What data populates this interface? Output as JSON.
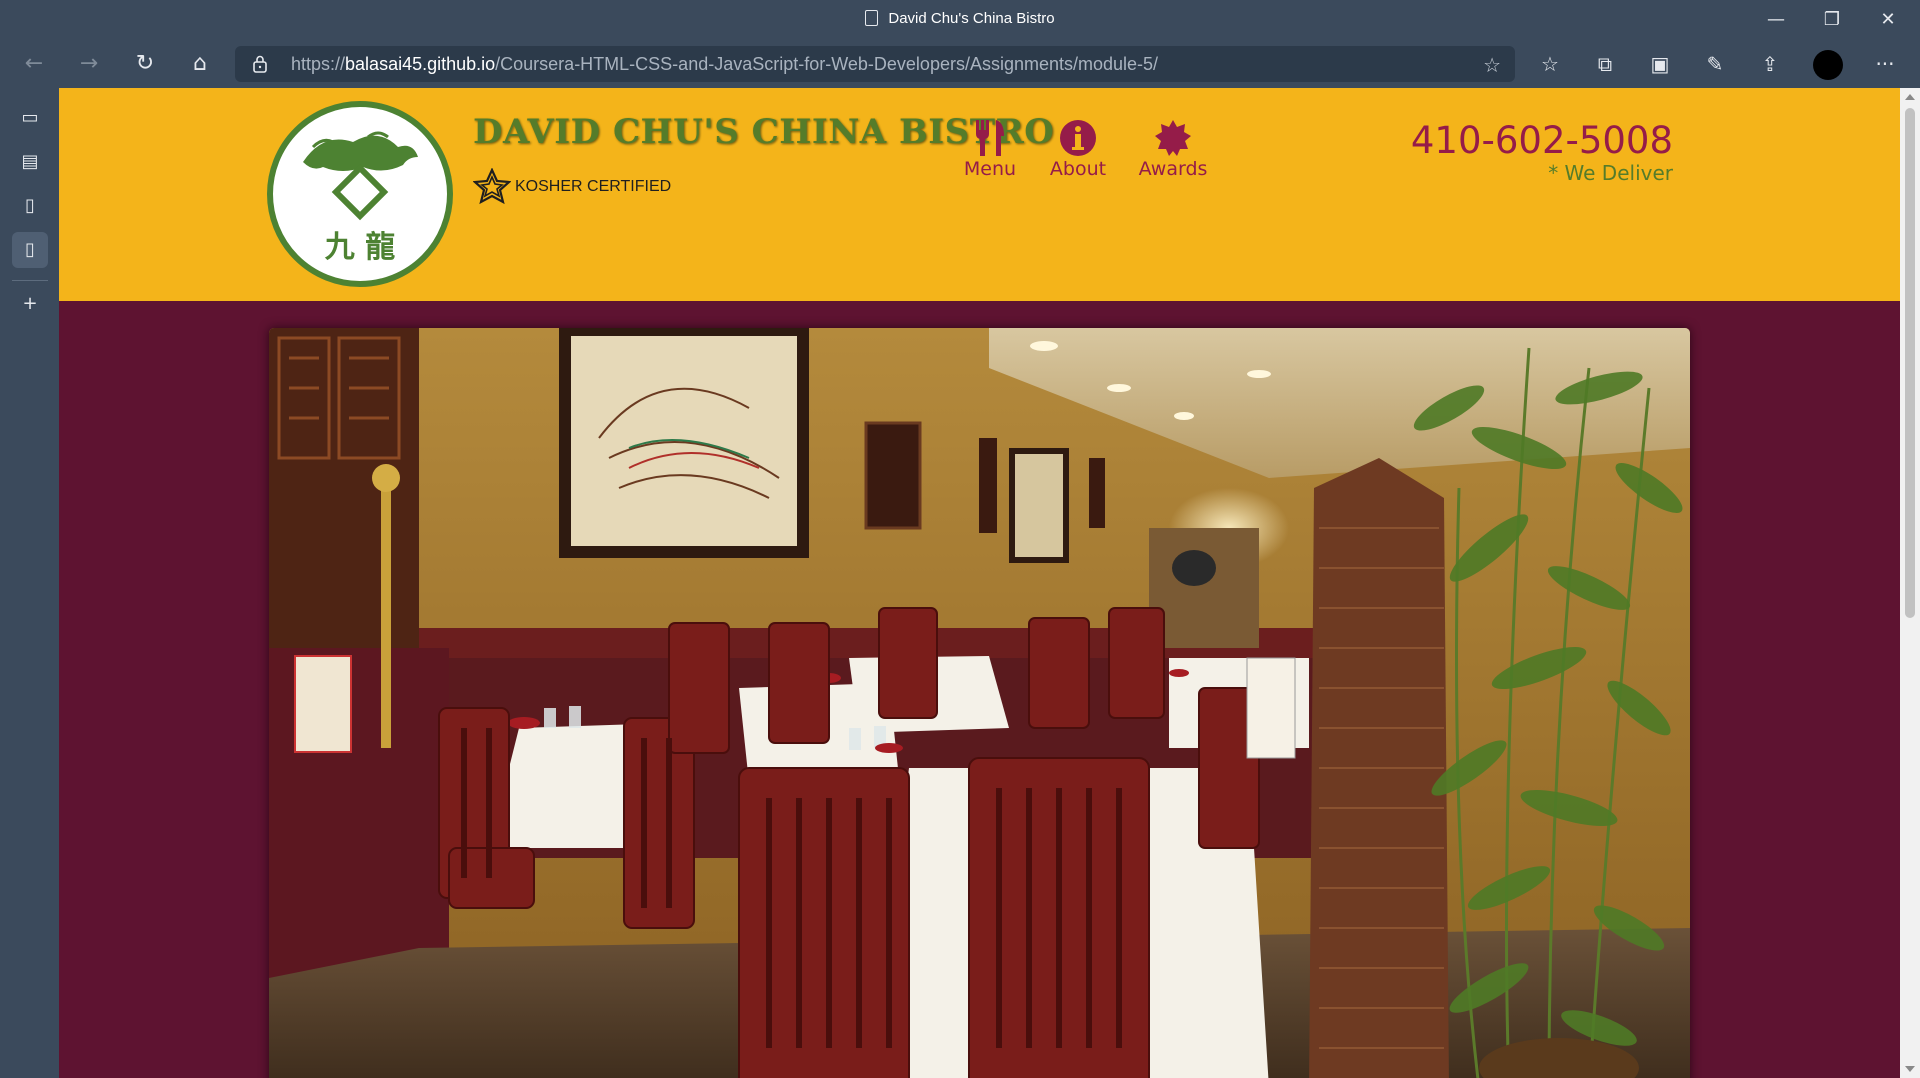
{
  "window": {
    "title": "David Chu's China Bistro",
    "controls": {
      "minimize": "—",
      "restore": "❐",
      "close": "✕"
    }
  },
  "toolbar": {
    "back": "←",
    "forward": "→",
    "refresh": "↻",
    "home": "⌂",
    "url_scheme": "https://",
    "url_host": "balasai45.github.io",
    "url_path": "/Coursera-HTML-CSS-and-JavaScript-for-Web-Developers/Assignments/module-5/",
    "icons": [
      "add-favorite-icon",
      "favorites-icon",
      "collections-icon",
      "math-solver-icon",
      "web-capture-icon",
      "share-icon",
      "profile-avatar",
      "more-icon"
    ],
    "more": "···"
  },
  "sidebar": {
    "items": [
      "tab-actions-icon",
      "history-icon",
      "page-icon",
      "page-icon-active"
    ],
    "add": "+"
  },
  "site": {
    "brand": "DAVID CHU'S CHINA BISTRO",
    "kosher": "KOSHER CERTIFIED",
    "nav": [
      {
        "label": "Menu",
        "icon": "utensils-icon"
      },
      {
        "label": "About",
        "icon": "info-icon"
      },
      {
        "label": "Awards",
        "icon": "certificate-icon"
      }
    ],
    "phone": "410-602-5008",
    "deliver": "* We Deliver",
    "logo_chars": "九 龍",
    "colors": {
      "header_bg": "#f4b41a",
      "page_bg": "#5e1331",
      "accent": "#951c49",
      "green": "#557c2a"
    }
  }
}
